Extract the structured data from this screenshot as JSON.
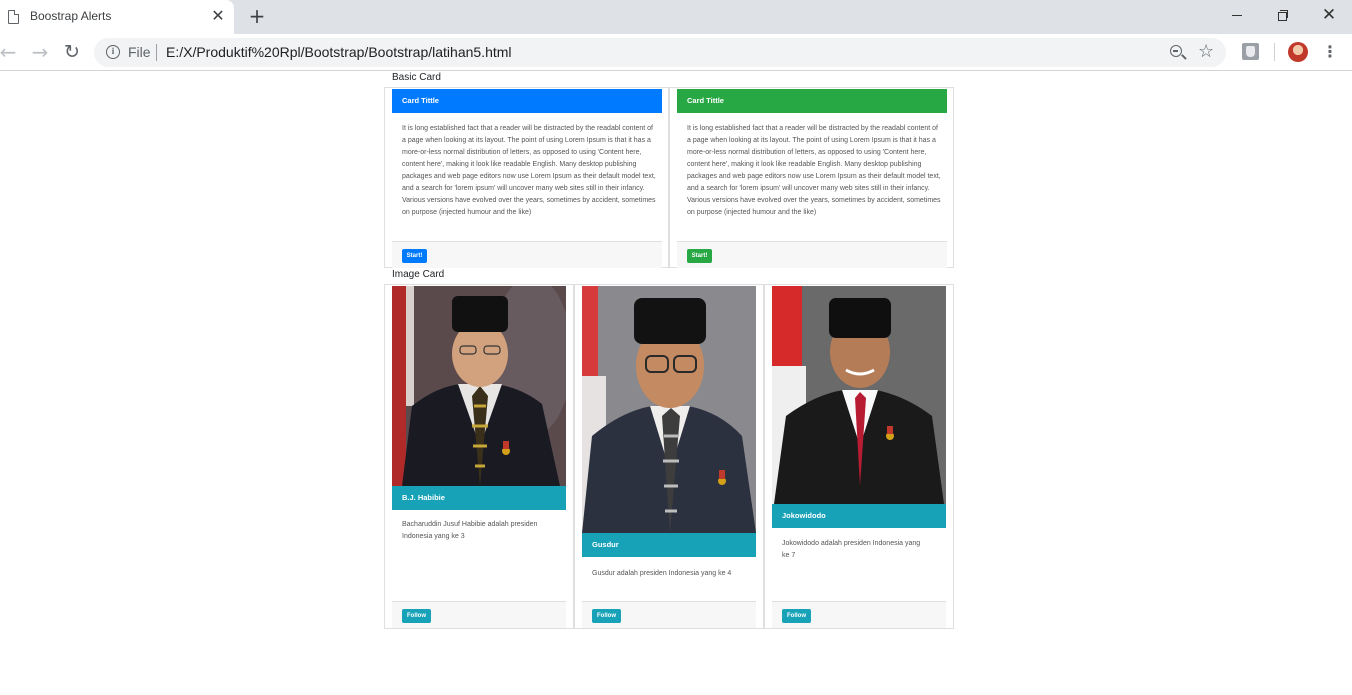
{
  "browser": {
    "tab_title": "Boostrap Alerts",
    "scheme_label": "File",
    "url": "E:/X/Produktif%20Rpl/Bootstrap/Bootstrap/latihan5.html"
  },
  "basic_section": {
    "title": "Basic Card",
    "cards": [
      {
        "header": "Card Tittle",
        "header_color": "#007bff",
        "body": "It is long established fact that a reader will be distracted by the readabl content of a page when looking at its layout. The point of using Lorem Ipsum is that it has a more-or-less normal distribution of letters, as opposed to using 'Content here, content here', making it look like readable English. Many desktop publishing packages and web page editors now use Lorem Ipsum as their default model text, and a search for 'lorem ipsum' will uncover many web sites still in their infancy. Various versions have evolved over the years, sometimes by accident, sometimes on purpose (injected humour and the like)",
        "button": "Start!"
      },
      {
        "header": "Card Tittle",
        "header_color": "#28a745",
        "body": "It is long established fact that a reader will be distracted by the readabl content of a page when looking at its layout. The point of using Lorem Ipsum is that it has a more-or-less normal distribution of letters, as opposed to using 'Content here, content here', making it look like readable English. Many desktop publishing packages and web page editors now use Lorem Ipsum as their default model text, and a search for 'lorem ipsum' will uncover many web sites still in their infancy. Various versions have evolved over the years, sometimes by accident, sometimes on purpose (injected humour and the like)",
        "button": "Start!"
      }
    ]
  },
  "image_section": {
    "title": "Image Card",
    "cards": [
      {
        "name": "B.J. Habibie",
        "description": "Bacharuddin Jusuf Habibie adalah presiden Indonesia yang ke 3",
        "button": "Follow"
      },
      {
        "name": "Gusdur",
        "description": "Gusdur adalah presiden Indonesia yang ke 4",
        "button": "Follow"
      },
      {
        "name": "Jokowidodo",
        "description": "Jokowidodo adalah presiden Indonesia yang ke 7",
        "button": "Follow"
      }
    ]
  },
  "colors": {
    "primary": "#007bff",
    "success": "#28a745",
    "info": "#17a2b8"
  }
}
